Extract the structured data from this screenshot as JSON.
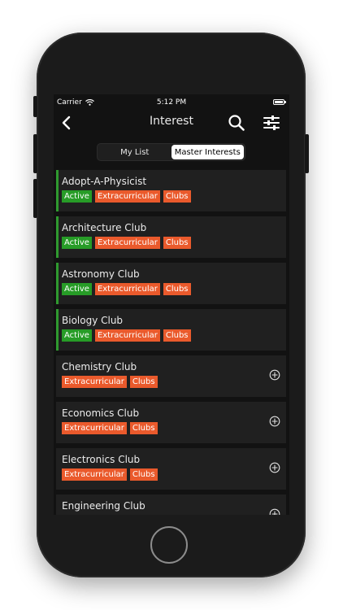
{
  "status_bar": {
    "carrier": "Carrier",
    "time": "5:12 PM",
    "battery_level": 1.0
  },
  "nav": {
    "title": "Interest",
    "back_icon": "chevron-left-icon",
    "search_icon": "search-icon",
    "filter_icon": "sliders-icon"
  },
  "tabs": [
    {
      "label": "My List",
      "selected": false
    },
    {
      "label": "Master Interests",
      "selected": true
    }
  ],
  "interests": [
    {
      "title": "Adopt-A-Physicist",
      "active": true,
      "tags": [
        "Active",
        "Extracurricular",
        "Clubs"
      ]
    },
    {
      "title": "Architecture Club",
      "active": true,
      "tags": [
        "Active",
        "Extracurricular",
        "Clubs"
      ]
    },
    {
      "title": "Astronomy Club",
      "active": true,
      "tags": [
        "Active",
        "Extracurricular",
        "Clubs"
      ]
    },
    {
      "title": "Biology Club",
      "active": true,
      "tags": [
        "Active",
        "Extracurricular",
        "Clubs"
      ]
    },
    {
      "title": "Chemistry Club",
      "active": false,
      "tags": [
        "Extracurricular",
        "Clubs"
      ]
    },
    {
      "title": "Economics Club",
      "active": false,
      "tags": [
        "Extracurricular",
        "Clubs"
      ]
    },
    {
      "title": "Electronics Club",
      "active": false,
      "tags": [
        "Extracurricular",
        "Clubs"
      ]
    },
    {
      "title": "Engineering Club",
      "active": false,
      "tags": []
    }
  ],
  "colors": {
    "active_tag": "#279c27",
    "category_tag": "#ea5a2c",
    "active_bar": "#2f9a2f",
    "row_bg": "#202020"
  }
}
